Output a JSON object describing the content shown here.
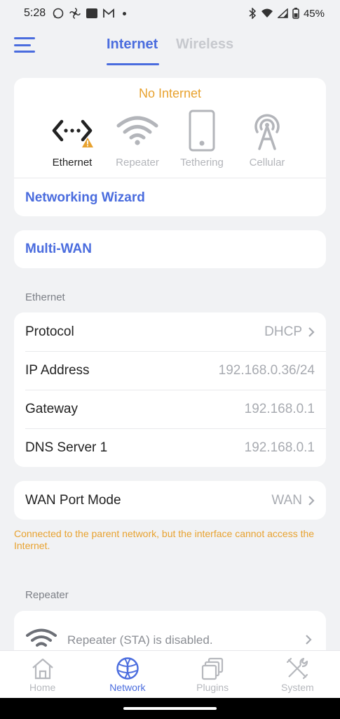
{
  "status_bar": {
    "time": "5:28",
    "battery": "45%"
  },
  "header": {
    "tabs": [
      {
        "label": "Internet"
      },
      {
        "label": "Wireless"
      }
    ]
  },
  "internet_card": {
    "status": "No Internet",
    "modes": [
      {
        "label": "Ethernet",
        "icon": "ethernet-icon"
      },
      {
        "label": "Repeater",
        "icon": "wifi-icon"
      },
      {
        "label": "Tethering",
        "icon": "phone-icon"
      },
      {
        "label": "Cellular",
        "icon": "antenna-icon"
      }
    ],
    "wizard_label": "Networking Wizard"
  },
  "multiwan_label": "Multi-WAN",
  "ethernet_section": {
    "title": "Ethernet",
    "rows": [
      {
        "key": "Protocol",
        "value": "DHCP"
      },
      {
        "key": "IP Address",
        "value": "192.168.0.36/24"
      },
      {
        "key": "Gateway",
        "value": "192.168.0.1"
      },
      {
        "key": "DNS Server 1",
        "value": "192.168.0.1"
      }
    ]
  },
  "wan_port": {
    "key": "WAN Port Mode",
    "value": "WAN"
  },
  "note": "Connected to the parent network, but the interface cannot access the Internet.",
  "repeater_section": {
    "title": "Repeater",
    "status": "Repeater (STA) is disabled."
  },
  "bottom_nav": [
    {
      "label": "Home"
    },
    {
      "label": "Network"
    },
    {
      "label": "Plugins"
    },
    {
      "label": "System"
    }
  ],
  "colors": {
    "accent": "#4a6cde",
    "warning": "#e8a22f",
    "muted": "#b3b5ba",
    "background": "#f1f2f4"
  }
}
